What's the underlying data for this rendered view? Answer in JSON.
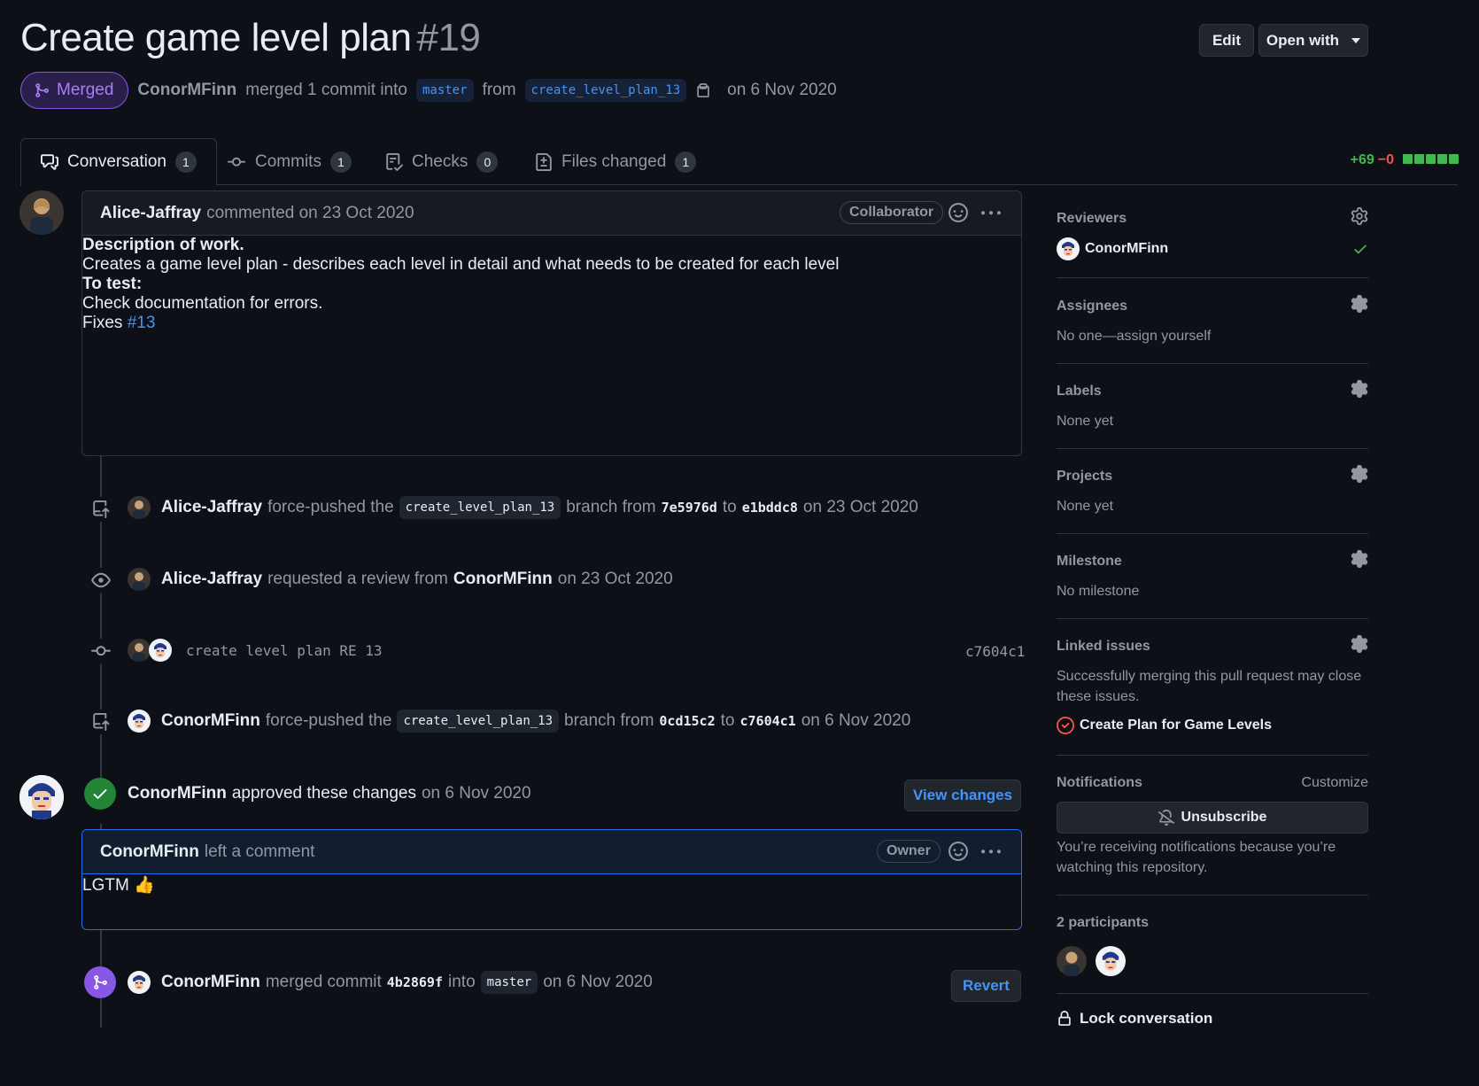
{
  "header": {
    "title": "Create game level plan",
    "number": "#19",
    "edit_label": "Edit",
    "open_with_label": "Open with",
    "state": "Merged",
    "author": "ConorMFinn",
    "merged_text": "merged 1 commit into",
    "base_branch": "master",
    "from_text": "from",
    "head_branch": "create_level_plan_13",
    "date_text": "on 6 Nov 2020"
  },
  "tabs": [
    {
      "label": "Conversation",
      "count": "1"
    },
    {
      "label": "Commits",
      "count": "1"
    },
    {
      "label": "Checks",
      "count": "0"
    },
    {
      "label": "Files changed",
      "count": "1"
    }
  ],
  "diffstat": {
    "additions": "+69",
    "deletions": "−0"
  },
  "first_comment": {
    "author": "Alice-Jaffray",
    "action": "commented on 23 Oct 2020",
    "role": "Collaborator",
    "heading1": "Description of work.",
    "line1": "Creates a game level plan - describes each level in detail and what needs to be created for each level",
    "heading2": "To test:",
    "line2": "Check documentation for errors.",
    "fixes_label": "Fixes",
    "fixes_ref": "#13"
  },
  "timeline": {
    "event1": {
      "who": "Alice-Jaffray",
      "t1": "force-pushed the",
      "branch": "create_level_plan_13",
      "t2": "branch from",
      "from_sha": "7e5976d",
      "t3": "to",
      "to_sha": "e1bddc8",
      "date": "on 23 Oct 2020"
    },
    "event2": {
      "who": "Alice-Jaffray",
      "t1": "requested a review from",
      "target": "ConorMFinn",
      "date": "on 23 Oct 2020"
    },
    "event3": {
      "message": "create level plan RE 13",
      "sha": "c7604c1"
    },
    "event4": {
      "who": "ConorMFinn",
      "t1": "force-pushed the",
      "branch": "create_level_plan_13",
      "t2": "branch from",
      "from_sha": "0cd15c2",
      "t3": "to",
      "to_sha": "c7604c1",
      "date": "on 6 Nov 2020"
    },
    "review": {
      "who": "ConorMFinn",
      "t1": "approved these changes",
      "date": "on 6 Nov 2020",
      "button": "View changes"
    },
    "review_comment": {
      "author": "ConorMFinn",
      "action": "left a comment",
      "role": "Owner",
      "body": "LGTM 👍"
    },
    "merge": {
      "who": "ConorMFinn",
      "t1": "merged commit",
      "sha": "4b2869f",
      "t2": "into",
      "branch": "master",
      "date": "on 6 Nov 2020",
      "button": "Revert"
    }
  },
  "sidebar": {
    "reviewers": {
      "label": "Reviewers",
      "name": "ConorMFinn"
    },
    "assignees": {
      "label": "Assignees",
      "value": "No one—assign yourself"
    },
    "labels": {
      "label": "Labels",
      "value": "None yet"
    },
    "projects": {
      "label": "Projects",
      "value": "None yet"
    },
    "milestone": {
      "label": "Milestone",
      "value": "No milestone"
    },
    "linked": {
      "label": "Linked issues",
      "value": "Successfully merging this pull request may close these issues.",
      "issue": "Create Plan for Game Levels"
    },
    "notifications": {
      "label": "Notifications",
      "customize": "Customize",
      "button": "Unsubscribe",
      "reason": "You’re receiving notifications because you’re watching this repository."
    },
    "participants": {
      "label": "2 participants"
    },
    "lock": {
      "label": "Lock conversation"
    }
  },
  "colors": {
    "merged": "#8957e5",
    "approved": "#238636",
    "link": "#4493f8",
    "bg": "#0d1117"
  }
}
